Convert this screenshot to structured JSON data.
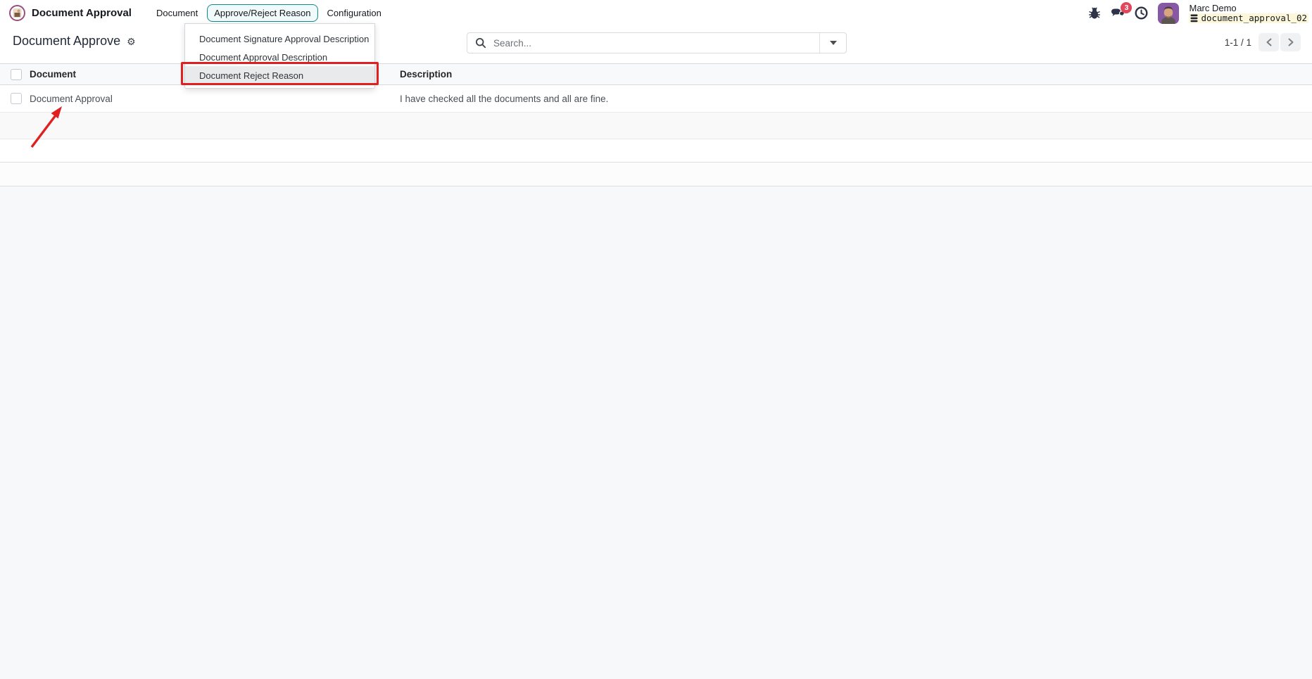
{
  "navbar": {
    "brand": "Document Approval",
    "menus": [
      {
        "label": "Document"
      },
      {
        "label": "Approve/Reject Reason"
      },
      {
        "label": "Configuration"
      }
    ],
    "message_badge_count": "3",
    "user": {
      "name": "Marc Demo",
      "database": "document_approval_02"
    }
  },
  "dropdown_menu": {
    "items": [
      {
        "label": "Document Signature Approval Description"
      },
      {
        "label": "Document Approval Description"
      },
      {
        "label": "Document Reject Reason"
      }
    ]
  },
  "control_panel": {
    "title": "Document Approve",
    "search_placeholder": "Search...",
    "pager_text": "1-1 / 1"
  },
  "table": {
    "columns": [
      {
        "label": "Document"
      },
      {
        "label": "Description"
      }
    ],
    "rows": [
      {
        "document": "Document Approval",
        "description": "I have checked all the documents and all are fine."
      }
    ]
  },
  "icons": {
    "gear": "⚙"
  },
  "colors": {
    "menu_active_border": "#0e8b8d",
    "menu_active_bg": "#f0fafa",
    "annotation_red": "#e02020",
    "badge_red": "#e1465a",
    "db_badge_bg": "#fcf6da",
    "app_ring_purple": "#96527c",
    "avatar_purple": "#8758a4"
  }
}
